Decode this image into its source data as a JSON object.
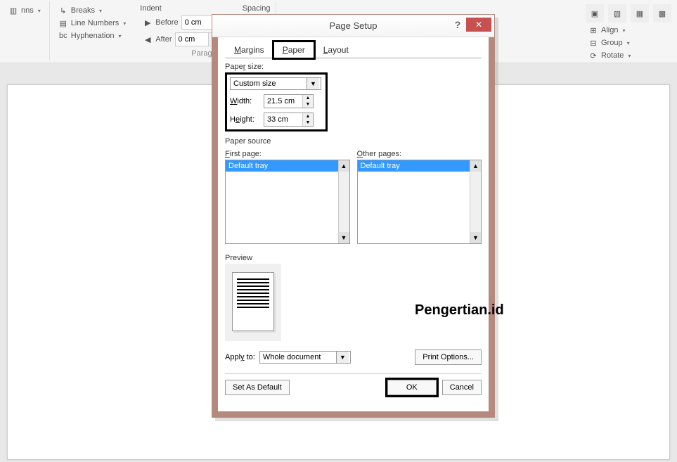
{
  "ribbon": {
    "columns_label": "nns",
    "breaks": "Breaks",
    "line_numbers": "Line Numbers",
    "hyphenation": "Hyphenation",
    "indent_header": "Indent",
    "spacing_header": "Spacing",
    "before": "Before",
    "after": "After",
    "before_val": "0 cm",
    "after_val": "0 cm",
    "paragraph_section": "Paragra",
    "align": "Align",
    "group": "Group",
    "rotate": "Rotate"
  },
  "dialog": {
    "title": "Page Setup",
    "tabs": {
      "margins": "Margins",
      "paper": "Paper",
      "layout": "Layout"
    },
    "paper_size_label": "Paper size:",
    "paper_size_value": "Custom size",
    "width_label": "Width:",
    "width_value": "21.5 cm",
    "height_label": "Height:",
    "height_value": "33 cm",
    "paper_source_label": "Paper source",
    "first_page_label": "First page:",
    "other_pages_label": "Other pages:",
    "default_tray": "Default tray",
    "preview_label": "Preview",
    "apply_to_label": "Apply to:",
    "apply_to_value": "Whole document",
    "print_options": "Print Options...",
    "set_default": "Set As Default",
    "ok": "OK",
    "cancel": "Cancel"
  },
  "watermark": "Pengertian.id"
}
